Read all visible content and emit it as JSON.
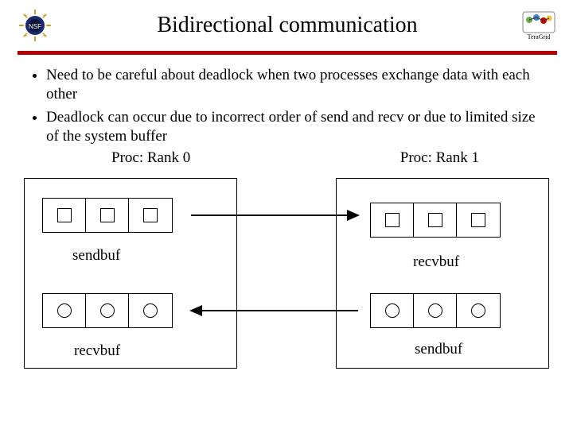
{
  "header": {
    "title": "Bidirectional communication",
    "left_logo": "nsf-logo",
    "right_logo": "teragrid-logo",
    "right_logo_label": "TeraGrid"
  },
  "bullets": [
    "Need to be careful about deadlock when two processes exchange data with each other",
    "Deadlock can occur due to incorrect order of send and recv or due to limited size of the system buffer"
  ],
  "diagram": {
    "proc0_label": "Proc: Rank 0",
    "proc1_label": "Proc: Rank 1",
    "proc0": {
      "top_buf_label": "sendbuf",
      "bottom_buf_label": "recvbuf",
      "top_shapes": [
        "square",
        "square",
        "square"
      ],
      "bottom_shapes": [
        "circle",
        "circle",
        "circle"
      ]
    },
    "proc1": {
      "top_buf_label": "recvbuf",
      "bottom_buf_label": "sendbuf",
      "top_shapes": [
        "square",
        "square",
        "square"
      ],
      "bottom_shapes": [
        "circle",
        "circle",
        "circle"
      ]
    },
    "arrows": {
      "top": "right",
      "bottom": "left"
    }
  }
}
